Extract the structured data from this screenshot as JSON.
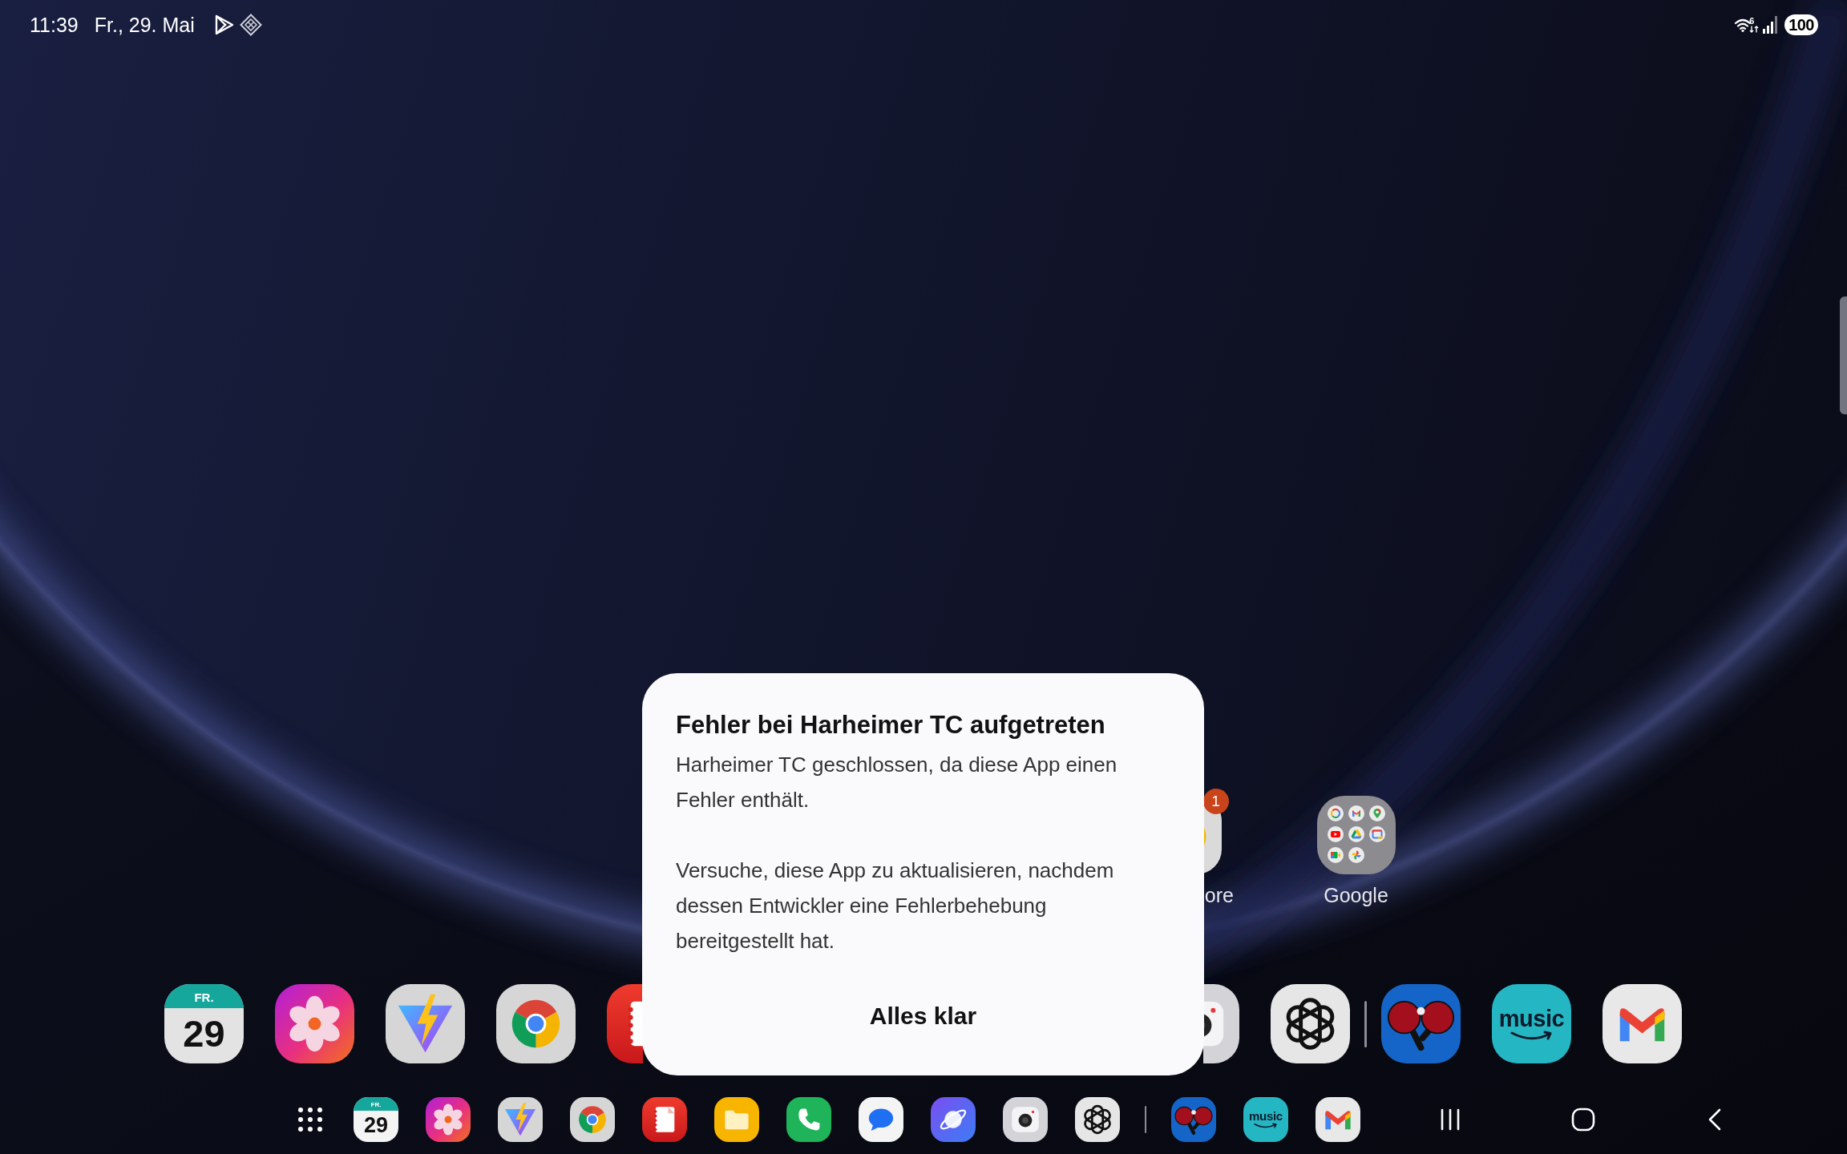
{
  "status_bar": {
    "time": "11:39",
    "date": "Fr., 29. Mai",
    "wifi_label": "6",
    "battery": "100"
  },
  "home_screen": {
    "items": [
      {
        "kind": "app",
        "label": "ore",
        "badge": "1",
        "left_hidden": true
      },
      {
        "kind": "folder",
        "label": "Google"
      }
    ]
  },
  "dialog": {
    "title": "Fehler bei Harheimer TC aufgetreten",
    "paragraphs": [
      "Harheimer TC geschlossen, da diese App einen Fehler enthält.",
      "Versuche, diese App zu aktualisieren, nachdem dessen Entwickler eine Fehlerbehebung bereitgestellt hat."
    ],
    "button": "Alles klar"
  },
  "dock": {
    "items": [
      {
        "kind": "calendar",
        "day": "FR.",
        "date": "29"
      },
      {
        "kind": "gallery"
      },
      {
        "kind": "vite"
      },
      {
        "kind": "chrome"
      },
      {
        "kind": "notes",
        "right_hidden": true
      },
      {
        "kind": "camera",
        "left_hidden": true
      },
      {
        "kind": "chatgpt"
      },
      {
        "kind": "divider"
      },
      {
        "kind": "table_tennis"
      },
      {
        "kind": "music",
        "text": "music"
      },
      {
        "kind": "gmail"
      }
    ]
  },
  "taskbar": {
    "items": [
      {
        "kind": "apps_menu"
      },
      {
        "kind": "calendar",
        "day": "FR.",
        "date": "29"
      },
      {
        "kind": "gallery"
      },
      {
        "kind": "vite"
      },
      {
        "kind": "chrome"
      },
      {
        "kind": "notes"
      },
      {
        "kind": "files"
      },
      {
        "kind": "phone"
      },
      {
        "kind": "messages"
      },
      {
        "kind": "internet"
      },
      {
        "kind": "camera"
      },
      {
        "kind": "chatgpt"
      },
      {
        "kind": "divider"
      },
      {
        "kind": "table_tennis"
      },
      {
        "kind": "music",
        "text": "music"
      },
      {
        "kind": "gmail"
      }
    ]
  },
  "navigation": [
    {
      "kind": "recents"
    },
    {
      "kind": "home"
    },
    {
      "kind": "back"
    }
  ]
}
